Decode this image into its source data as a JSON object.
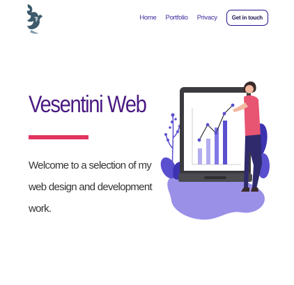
{
  "brand": {
    "logo_icon": "eagle-logo-icon",
    "color": "#3d5a6c"
  },
  "nav": {
    "items": [
      {
        "label": "Home"
      },
      {
        "label": "Portfolio"
      },
      {
        "label": "Privacy"
      }
    ],
    "cta_label": "Get in touch"
  },
  "hero": {
    "title": "Vesentini Web",
    "description": "Welcome to a selection of my web design and development work.",
    "accent_color": "#e2345f",
    "title_color": "#4b1a82"
  },
  "illustration": {
    "icon": "analytics-presentation-illustration",
    "bar_levels": [
      0.35,
      0.55,
      0.8,
      0.95
    ]
  }
}
